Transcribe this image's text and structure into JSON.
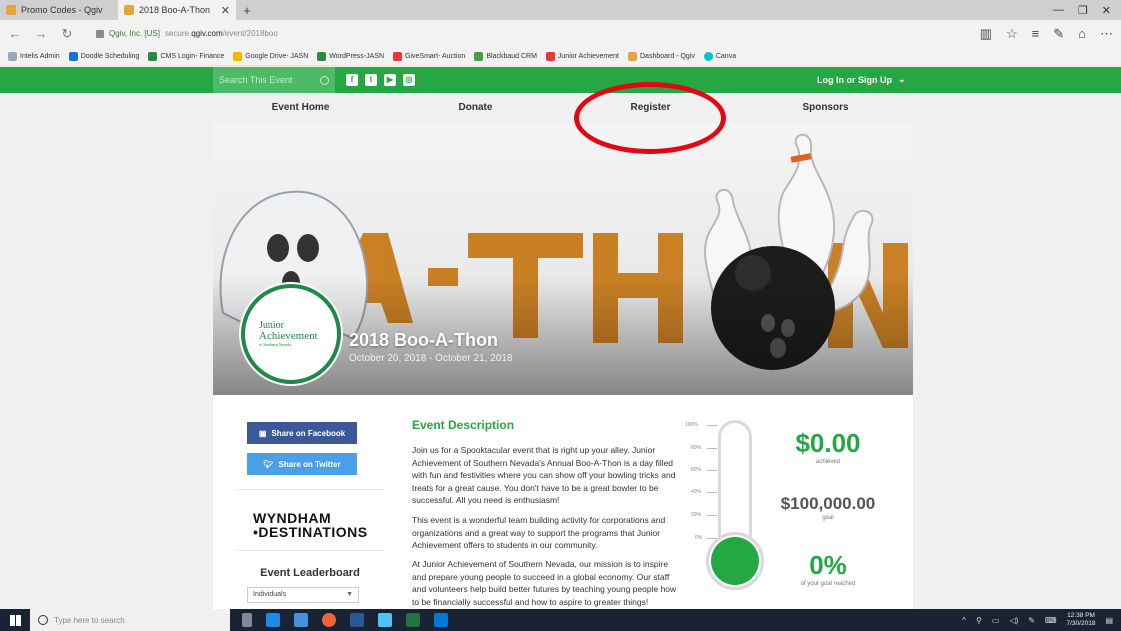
{
  "browser": {
    "tabs": [
      {
        "title": "Promo Codes - Qgiv",
        "active": false
      },
      {
        "title": "2018 Boo-A-Thon",
        "active": true
      }
    ],
    "address": {
      "site_identity": "Qgiv, Inc. [US]",
      "url_prefix": "secure.",
      "url_domain": "qgiv.com",
      "url_path": "/event/2018boo"
    },
    "favorites": [
      {
        "label": "Intelis Admin",
        "color": "#9aa7b8"
      },
      {
        "label": "Doodle Scheduling",
        "color": "#1c6fd6"
      },
      {
        "label": "CMS Login- Finance",
        "color": "#2a8a3f"
      },
      {
        "label": "Google Drive- JASN",
        "color": "#f4b400"
      },
      {
        "label": "WordPress-JASN",
        "color": "#2a8a3f"
      },
      {
        "label": "GiveSmart- Auction",
        "color": "#e53935"
      },
      {
        "label": "Blackbaud CRM",
        "color": "#43a047"
      },
      {
        "label": "Junior Achievement",
        "color": "#e53935"
      },
      {
        "label": "Dashboard - Qgiv",
        "color": "#e8a43a"
      },
      {
        "label": "Canva",
        "color": "#00c4cc"
      }
    ]
  },
  "site": {
    "search_placeholder": "Search This Event",
    "login_label": "Log In or Sign Up",
    "nav": [
      {
        "label": "Event Home"
      },
      {
        "label": "Donate"
      },
      {
        "label": "Register"
      },
      {
        "label": "Sponsors"
      }
    ],
    "hero": {
      "title": "2018 Boo-A-Thon",
      "dates": "October 20, 2018 - October 21, 2018",
      "logo_line1": "Junior",
      "logo_line2": "Achievement",
      "logo_line3": "of Southern Nevada"
    },
    "share": {
      "facebook": "Share on Facebook",
      "twitter": "Share on Twitter"
    },
    "sponsor_logo_line1": "WYNDHAM",
    "sponsor_logo_line2": "•DESTINATIONS",
    "leaderboard": {
      "title": "Event Leaderboard",
      "selected": "Individuals"
    },
    "description": {
      "title": "Event Description",
      "p1": "Join us for a Spooktacular event that is right up your alley. Junior Achievement of Southern Nevada's Annual Boo-A-Thon is a day filled with fun and festivities where you can show off your bowling tricks and treats for a great cause. You don't have to be a great bowler to be successful. All you need is enthusiasm!",
      "p2": "This event is a wonderful team building activity for corporations and organizations and a great way to support the programs that Junior Achievement offers to students in our community.",
      "p3": "At Junior Achievement of Southern Nevada, our mission is to inspire and prepare young people to succeed in a global economy. Our staff and volunteers help build better futures by teaching young people how to be financially successful and how to aspire to greater things!"
    },
    "progress": {
      "ticks": [
        "100%",
        "80%",
        "60%",
        "40%",
        "20%",
        "0%"
      ],
      "achieved": "$0.00",
      "achieved_label": "achieved",
      "goal": "$100,000.00",
      "goal_label": "goal",
      "percent": "0%",
      "percent_label": "of your goal reached",
      "fill_fraction": 0
    }
  },
  "taskbar": {
    "search_placeholder": "Type here to search",
    "time": "12:38 PM",
    "date": "7/30/2018"
  },
  "colors": {
    "brand_green": "#25a744",
    "annotation_red": "#e30613"
  }
}
